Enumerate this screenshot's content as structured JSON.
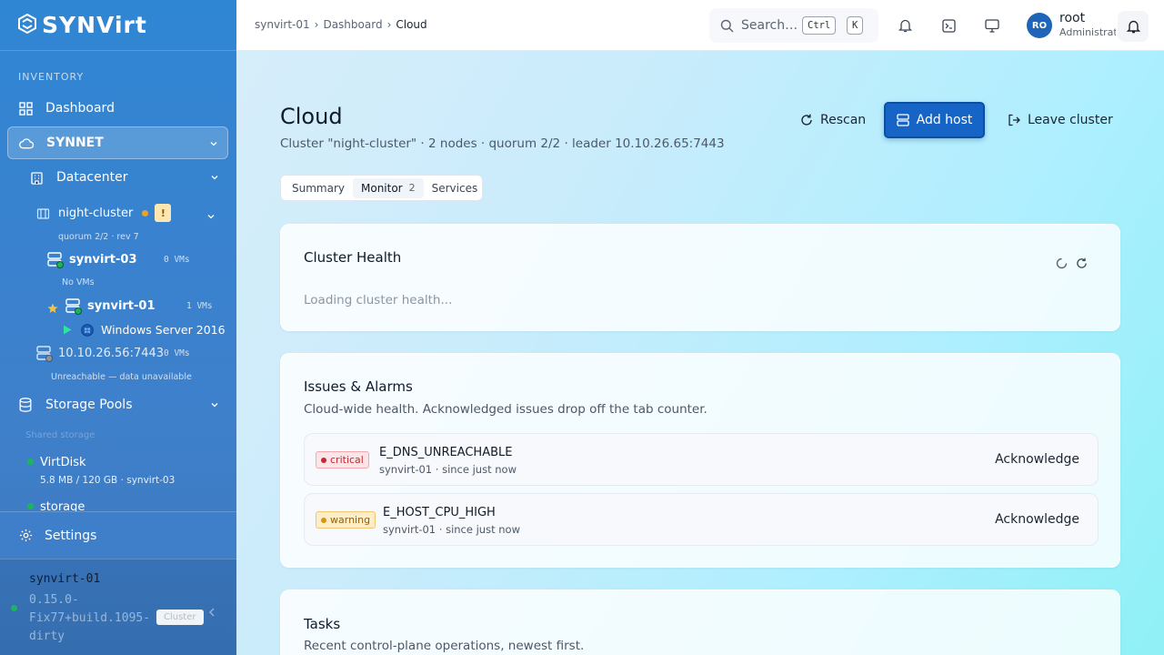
{
  "brand": {
    "name": "SYNVirt"
  },
  "sidebar": {
    "section_label": "INVENTORY",
    "dashboard": "Dashboard",
    "synnet": "SYNNET",
    "datacenter": "Datacenter",
    "cluster": {
      "name": "night-cluster",
      "badge": "!",
      "meta": "quorum 2/2 · rev 7"
    },
    "hosts": [
      {
        "name": "synvirt-03",
        "vms": "0 VMs",
        "note": "No VMs"
      },
      {
        "name": "synvirt-01",
        "vms": "1 VMs",
        "vm": "Windows Server 2016"
      },
      {
        "name": "10.10.26.56:7443",
        "vms": "0 VMs",
        "note": "Unreachable — data unavailable"
      }
    ],
    "storage_pools": "Storage Pools",
    "shared_storage": "Shared storage",
    "pools": [
      {
        "name": "VirtDisk",
        "meta": "5.8 MB / 120 GB · synvirt-03"
      },
      {
        "name": "storage"
      }
    ],
    "settings": "Settings",
    "footer": {
      "host": "synvirt-01",
      "version": "0.15.0-Fix77+build.1095-dirty",
      "badge": "Cluster"
    }
  },
  "topbar": {
    "breadcrumbs": [
      "synvirt-01",
      "Dashboard",
      "Cloud"
    ],
    "search_placeholder": "Search…",
    "kbd_ctrl": "Ctrl",
    "kbd_k": "K",
    "avatar_initials": "RO",
    "user_name": "root",
    "user_role": "Administrator"
  },
  "page": {
    "title": "Cloud",
    "subtitle": "Cluster \"night-cluster\" · 2 nodes · quorum 2/2 · leader 10.10.26.65:7443",
    "actions": {
      "rescan": "Rescan",
      "add_host": "Add host",
      "leave_cluster": "Leave cluster"
    },
    "tabs": [
      {
        "label": "Summary"
      },
      {
        "label": "Monitor",
        "count": "2"
      },
      {
        "label": "Services"
      }
    ]
  },
  "health": {
    "title": "Cluster Health",
    "loading": "Loading cluster health..."
  },
  "issues": {
    "title": "Issues & Alarms",
    "description": "Cloud-wide health. Acknowledged issues drop off the tab counter.",
    "items": [
      {
        "severity": "critical",
        "code": "E_DNS_UNREACHABLE",
        "meta": "synvirt-01 · since just now",
        "action": "Acknowledge"
      },
      {
        "severity": "warning",
        "code": "E_HOST_CPU_HIGH",
        "meta": "synvirt-01 · since just now",
        "action": "Acknowledge"
      }
    ]
  },
  "tasks": {
    "title": "Tasks",
    "description": "Recent control-plane operations, newest first."
  },
  "colors": {
    "accent": "#1665c6",
    "critical": "#c62734",
    "warning": "#93620a",
    "online": "#1bb55c",
    "cluster_dot": "#f0a020"
  }
}
